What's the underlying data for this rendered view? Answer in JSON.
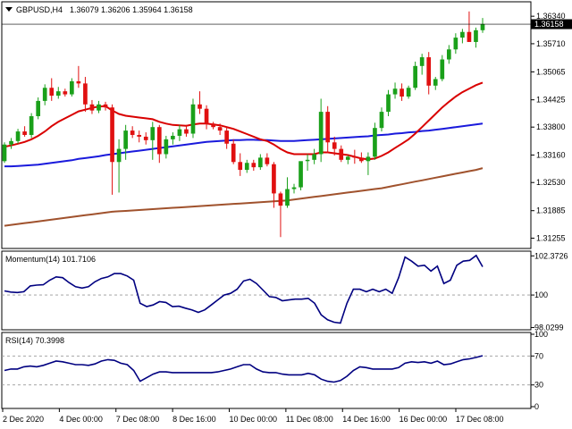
{
  "header": {
    "symbol": "GBPUSD,H4",
    "ohlc": "1.36079 1.36206 1.35964 1.36158",
    "current_price": "1.36158"
  },
  "colors": {
    "up_candle": "#1aa01a",
    "down_candle": "#e01010",
    "ma_fast": "#d90000",
    "ma_mid": "#1a1adc",
    "ma_slow": "#a0522d",
    "indicator_line": "#000080",
    "current_price_label_bg": "#000000"
  },
  "chart_data": [
    {
      "type": "candlestick",
      "title": "GBPUSD,H4",
      "ylim": [
        1.3106,
        1.3663
      ],
      "y_ticks": [
        "1.36340",
        "1.35710",
        "1.35065",
        "1.34425",
        "1.33800",
        "1.33160",
        "1.32530",
        "1.31885",
        "1.31255"
      ],
      "x_tick_labels": [
        "2 Dec 2020",
        "4 Dec 00:00",
        "7 Dec 08:00",
        "8 Dec 16:00",
        "10 Dec 00:00",
        "11 Dec 08:00",
        "14 Dec 16:00",
        "16 Dec 00:00",
        "17 Dec 08:00"
      ],
      "candles": [
        [
          1.3302,
          1.3345,
          1.3298,
          1.334
        ],
        [
          1.334,
          1.3355,
          1.333,
          1.3348
        ],
        [
          1.3348,
          1.3376,
          1.3342,
          1.337
        ],
        [
          1.337,
          1.3382,
          1.3358,
          1.3362
        ],
        [
          1.3362,
          1.3412,
          1.3355,
          1.3405
        ],
        [
          1.3405,
          1.3448,
          1.3398,
          1.344
        ],
        [
          1.344,
          1.3478,
          1.343,
          1.347
        ],
        [
          1.347,
          1.3492,
          1.344,
          1.3452
        ],
        [
          1.3452,
          1.3472,
          1.3445,
          1.3462
        ],
        [
          1.3462,
          1.3468,
          1.345,
          1.3455
        ],
        [
          1.3455,
          1.3492,
          1.345,
          1.3485
        ],
        [
          1.3485,
          1.352,
          1.347,
          1.348
        ],
        [
          1.348,
          1.3495,
          1.3415,
          1.3432
        ],
        [
          1.3432,
          1.3442,
          1.341,
          1.3418
        ],
        [
          1.3418,
          1.344,
          1.3412,
          1.3432
        ],
        [
          1.3432,
          1.3438,
          1.3418,
          1.3425
        ],
        [
          1.3425,
          1.3432,
          1.3225,
          1.33
        ],
        [
          1.33,
          1.3352,
          1.323,
          1.333
        ],
        [
          1.333,
          1.3385,
          1.3305,
          1.3372
        ],
        [
          1.3372,
          1.3382,
          1.3355,
          1.3362
        ],
        [
          1.3362,
          1.3372,
          1.3345,
          1.3358
        ],
        [
          1.3358,
          1.3368,
          1.334,
          1.335
        ],
        [
          1.335,
          1.3392,
          1.3305,
          1.338
        ],
        [
          1.338,
          1.3385,
          1.3298,
          1.3318
        ],
        [
          1.3318,
          1.336,
          1.3308,
          1.3352
        ],
        [
          1.3352,
          1.3368,
          1.334,
          1.336
        ],
        [
          1.336,
          1.3385,
          1.3348,
          1.3375
        ],
        [
          1.3375,
          1.3385,
          1.3358,
          1.3365
        ],
        [
          1.3365,
          1.3445,
          1.3355,
          1.3432
        ],
        [
          1.3432,
          1.3462,
          1.341,
          1.3422
        ],
        [
          1.3422,
          1.343,
          1.3375,
          1.3388
        ],
        [
          1.3388,
          1.3392,
          1.3375,
          1.338
        ],
        [
          1.338,
          1.3388,
          1.3362,
          1.3372
        ],
        [
          1.3372,
          1.338,
          1.333,
          1.3342
        ],
        [
          1.3342,
          1.3352,
          1.3295,
          1.33
        ],
        [
          1.33,
          1.332,
          1.3268,
          1.3282
        ],
        [
          1.3282,
          1.3305,
          1.3275,
          1.3298
        ],
        [
          1.3298,
          1.3305,
          1.328,
          1.3288
        ],
        [
          1.3288,
          1.3318,
          1.3282,
          1.331
        ],
        [
          1.331,
          1.332,
          1.329,
          1.3295
        ],
        [
          1.3295,
          1.33,
          1.3195,
          1.3228
        ],
        [
          1.3228,
          1.3232,
          1.3128,
          1.32
        ],
        [
          1.32,
          1.3265,
          1.3195,
          1.3238
        ],
        [
          1.3238,
          1.325,
          1.3228,
          1.3242
        ],
        [
          1.3242,
          1.33,
          1.3235,
          1.3302
        ],
        [
          1.3302,
          1.3318,
          1.328,
          1.3305
        ],
        [
          1.3305,
          1.333,
          1.3295,
          1.3318
        ],
        [
          1.3318,
          1.3445,
          1.33,
          1.3415
        ],
        [
          1.3415,
          1.3428,
          1.332,
          1.3345
        ],
        [
          1.3345,
          1.3358,
          1.3315,
          1.333
        ],
        [
          1.333,
          1.3338,
          1.33,
          1.3305
        ],
        [
          1.3305,
          1.3315,
          1.3295,
          1.3312
        ],
        [
          1.3312,
          1.3328,
          1.3296,
          1.331
        ],
        [
          1.331,
          1.3322,
          1.3298,
          1.3302
        ],
        [
          1.3302,
          1.3322,
          1.327,
          1.3312
        ],
        [
          1.3312,
          1.339,
          1.3305,
          1.3378
        ],
        [
          1.3378,
          1.3425,
          1.337,
          1.3415
        ],
        [
          1.3415,
          1.3465,
          1.3405,
          1.3455
        ],
        [
          1.3455,
          1.3482,
          1.3445,
          1.3468
        ],
        [
          1.3468,
          1.348,
          1.344,
          1.345
        ],
        [
          1.345,
          1.3475,
          1.3445,
          1.347
        ],
        [
          1.347,
          1.353,
          1.3465,
          1.352
        ],
        [
          1.352,
          1.3548,
          1.35,
          1.354
        ],
        [
          1.354,
          1.3552,
          1.3455,
          1.3475
        ],
        [
          1.3475,
          1.3495,
          1.3465,
          1.349
        ],
        [
          1.349,
          1.3545,
          1.3485,
          1.3535
        ],
        [
          1.3535,
          1.3568,
          1.3525,
          1.3558
        ],
        [
          1.3558,
          1.3595,
          1.3548,
          1.3585
        ],
        [
          1.3585,
          1.3605,
          1.3572,
          1.3598
        ],
        [
          1.3598,
          1.3645,
          1.358,
          1.3575
        ],
        [
          1.3575,
          1.3608,
          1.3562,
          1.3602
        ],
        [
          1.3602,
          1.363,
          1.3596,
          1.3616
        ]
      ],
      "ma_fast": [
        1.3335,
        1.3338,
        1.3342,
        1.3346,
        1.3352,
        1.336,
        1.337,
        1.3382,
        1.3392,
        1.34,
        1.3408,
        1.3416,
        1.342,
        1.3424,
        1.3427,
        1.3428,
        1.3418,
        1.341,
        1.3406,
        1.3404,
        1.3402,
        1.34,
        1.3398,
        1.3392,
        1.3388,
        1.3385,
        1.3384,
        1.3383,
        1.3386,
        1.3388,
        1.3388,
        1.3386,
        1.3384,
        1.338,
        1.3376,
        1.337,
        1.3364,
        1.3358,
        1.3352,
        1.3348,
        1.334,
        1.333,
        1.3322,
        1.3318,
        1.3318,
        1.3318,
        1.3318,
        1.3322,
        1.3322,
        1.332,
        1.3318,
        1.3316,
        1.3312,
        1.3308,
        1.3306,
        1.3308,
        1.3314,
        1.3322,
        1.3332,
        1.3342,
        1.3352,
        1.3365,
        1.338,
        1.3395,
        1.341,
        1.3425,
        1.3438,
        1.345,
        1.346,
        1.3468,
        1.3476,
        1.3482
      ],
      "ma_mid": [
        1.329,
        1.329,
        1.3291,
        1.3292,
        1.3293,
        1.3294,
        1.3296,
        1.3298,
        1.33,
        1.3302,
        1.3304,
        1.3307,
        1.3309,
        1.3311,
        1.3313,
        1.3316,
        1.3318,
        1.332,
        1.3322,
        1.3324,
        1.3326,
        1.3328,
        1.333,
        1.3332,
        1.3334,
        1.3336,
        1.3338,
        1.334,
        1.3342,
        1.3344,
        1.3346,
        1.3347,
        1.3348,
        1.3349,
        1.335,
        1.335,
        1.3351,
        1.3351,
        1.335,
        1.335,
        1.3349,
        1.3348,
        1.3348,
        1.3348,
        1.3349,
        1.335,
        1.3351,
        1.3352,
        1.3353,
        1.3354,
        1.3355,
        1.3356,
        1.3357,
        1.3358,
        1.3359,
        1.3361,
        1.3362,
        1.3363,
        1.3365,
        1.3366,
        1.3368,
        1.3369,
        1.3371,
        1.3372,
        1.3374,
        1.3376,
        1.3378,
        1.338,
        1.3382,
        1.3384,
        1.3386,
        1.3388
      ],
      "ma_slow": [
        1.3154,
        1.3156,
        1.3158,
        1.316,
        1.3162,
        1.3164,
        1.3166,
        1.3168,
        1.317,
        1.3172,
        1.3174,
        1.3176,
        1.3178,
        1.318,
        1.3182,
        1.3184,
        1.3186,
        1.3187,
        1.3188,
        1.3189,
        1.319,
        1.3191,
        1.3192,
        1.3193,
        1.3194,
        1.3195,
        1.3196,
        1.3197,
        1.3198,
        1.3199,
        1.32,
        1.3201,
        1.3202,
        1.3203,
        1.3204,
        1.3205,
        1.3206,
        1.3207,
        1.3208,
        1.3209,
        1.321,
        1.3211,
        1.3212,
        1.3214,
        1.3216,
        1.3218,
        1.322,
        1.3222,
        1.3224,
        1.3226,
        1.3228,
        1.323,
        1.3232,
        1.3234,
        1.3236,
        1.3238,
        1.324,
        1.3243,
        1.3246,
        1.3249,
        1.3252,
        1.3255,
        1.3258,
        1.3261,
        1.3264,
        1.3267,
        1.327,
        1.3273,
        1.3276,
        1.3279,
        1.3282,
        1.3286
      ]
    },
    {
      "type": "line",
      "title": "Momentum(14) 101.7106",
      "label": "Momentum(14)",
      "current_value": "101.7106",
      "ylim": [
        98.0,
        102.55
      ],
      "y_tick_labels": [
        "102.3726",
        "100",
        "98.0299"
      ],
      "y_tick_values": [
        102.3726,
        100.0,
        98.0299
      ],
      "dashed_level": 100,
      "values": [
        100.25,
        100.18,
        100.15,
        100.2,
        100.55,
        100.6,
        100.62,
        100.9,
        101.1,
        101.05,
        100.75,
        100.5,
        100.42,
        100.5,
        100.8,
        101.0,
        101.1,
        101.3,
        101.3,
        101.15,
        100.9,
        99.5,
        99.3,
        99.4,
        99.6,
        99.55,
        99.3,
        99.32,
        99.2,
        99.1,
        98.95,
        99.1,
        99.4,
        99.7,
        100.0,
        100.1,
        100.35,
        100.85,
        100.95,
        100.7,
        100.3,
        99.9,
        99.85,
        99.65,
        99.7,
        99.75,
        99.75,
        99.8,
        99.5,
        98.8,
        98.5,
        98.35,
        98.3,
        99.5,
        100.35,
        100.35,
        100.2,
        100.35,
        100.2,
        100.35,
        100.1,
        101.05,
        102.3,
        102.05,
        101.75,
        101.8,
        101.45,
        101.75,
        100.7,
        100.9,
        101.8,
        102.05,
        102.1,
        102.4,
        101.71
      ],
      "x_tick_labels": [
        "2 Dec 2020",
        "4 Dec 00:00",
        "7 Dec 08:00",
        "8 Dec 16:00",
        "10 Dec 00:00",
        "11 Dec 08:00",
        "14 Dec 16:00",
        "16 Dec 00:00",
        "17 Dec 08:00"
      ]
    },
    {
      "type": "line",
      "title": "RSI(14) 70.3998",
      "label": "RSI(14)",
      "current_value": "70.3998",
      "ylim": [
        0,
        100
      ],
      "y_tick_labels": [
        "100",
        "70",
        "30",
        "0"
      ],
      "y_tick_values": [
        100,
        70,
        30,
        0
      ],
      "dashed_levels": [
        70,
        30
      ],
      "values": [
        50,
        52,
        52,
        55,
        56,
        55,
        57,
        60,
        63,
        62,
        60,
        58,
        58,
        57,
        59,
        63,
        65,
        64,
        60,
        58,
        50,
        35,
        40,
        45,
        48,
        48,
        47,
        47,
        47,
        47,
        47,
        47,
        47,
        48,
        50,
        52,
        55,
        58,
        58,
        52,
        48,
        47,
        47,
        45,
        44,
        44,
        44,
        46,
        44,
        38,
        35,
        34,
        36,
        42,
        50,
        55,
        54,
        52,
        52,
        52,
        52,
        54,
        60,
        62,
        61,
        62,
        60,
        63,
        58,
        59,
        62,
        65,
        66,
        68,
        70.4
      ]
    }
  ]
}
